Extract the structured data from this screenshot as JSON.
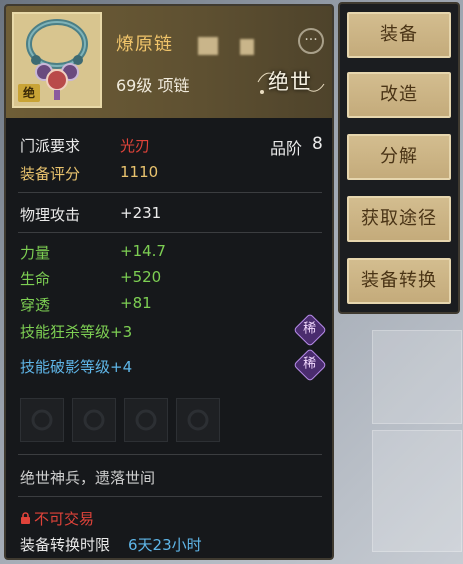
{
  "item": {
    "name": "燎原链",
    "level_type": "69级 项链",
    "grade": "绝世",
    "tier_badge": "绝",
    "more_button": "···"
  },
  "requirements": {
    "school_label": "门派要求",
    "school_value": "光刃",
    "rank_label": "品阶",
    "rank_value": "8",
    "score_label": "装备评分",
    "score_value": "1110"
  },
  "base_stats": [
    {
      "label": "物理攻击",
      "value": "+231"
    }
  ],
  "bonus_stats": [
    {
      "label": "力量",
      "value": "+14.7"
    },
    {
      "label": "生命",
      "value": "+520"
    },
    {
      "label": "穿透",
      "value": "+81"
    }
  ],
  "skills": [
    {
      "text": "技能狂杀等级+3",
      "badge": "稀",
      "color": "green"
    },
    {
      "text": "技能破影等级+4",
      "badge": "稀",
      "color": "blue"
    }
  ],
  "flavor": "绝世神兵，遗落世间",
  "trade": {
    "status": "不可交易",
    "convert_label": "装备转换时限",
    "convert_value": "6天23小时"
  },
  "actions": [
    {
      "label": "装备"
    },
    {
      "label": "改造"
    },
    {
      "label": "分解"
    },
    {
      "label": "获取途径"
    },
    {
      "label": "装备转换"
    }
  ],
  "colors": {
    "name": "#f0c46a",
    "school_value": "#e0433a",
    "green_stat": "#7dcf53",
    "blue_skill": "#5fb6e8",
    "button_bg": "#c9b083"
  }
}
